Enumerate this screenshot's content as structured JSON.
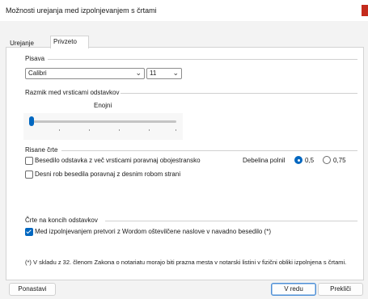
{
  "window": {
    "title": "Možnosti urejanja med izpolnjevanjem s črtami"
  },
  "tabs": [
    {
      "label": "Urejanje",
      "active": false
    },
    {
      "label": "Privzeto",
      "active": true
    }
  ],
  "font": {
    "group_label": "Pisava",
    "family_value": "Calibri",
    "size_value": "11"
  },
  "spacing": {
    "group_label": "Razmik med vrsticami odstavkov",
    "value_label": "Enojni",
    "level": 0
  },
  "lines": {
    "group_label": "Risane črte",
    "justify_label": "Besedilo odstavka z več vrsticami poravnaj obojestransko",
    "justify_checked": false,
    "right_edge_label": "Desni rob besedila poravnaj z desnim robom strani",
    "right_edge_checked": false,
    "thickness_label": "Debelina polnil",
    "thickness_options": [
      {
        "label": "0,5",
        "checked": true
      },
      {
        "label": "0,75",
        "checked": false
      }
    ]
  },
  "end_lines": {
    "group_label": "Črte na koncih odstavkov",
    "convert_label": "Med izpolnjevanjem pretvori z Wordom oštevilčene naslove v navadno besedilo (*)",
    "convert_checked": true
  },
  "footnote": "(*) V skladu z 32. členom Zakona o notariatu morajo biti prazna mesta v notarski listini v fizični obliki izpolnjena s črtami.",
  "buttons": {
    "reset": "Ponastavi",
    "ok": "V redu",
    "cancel": "Prekliči"
  },
  "colors": {
    "accent": "#0067c0",
    "close": "#c42b1c"
  }
}
